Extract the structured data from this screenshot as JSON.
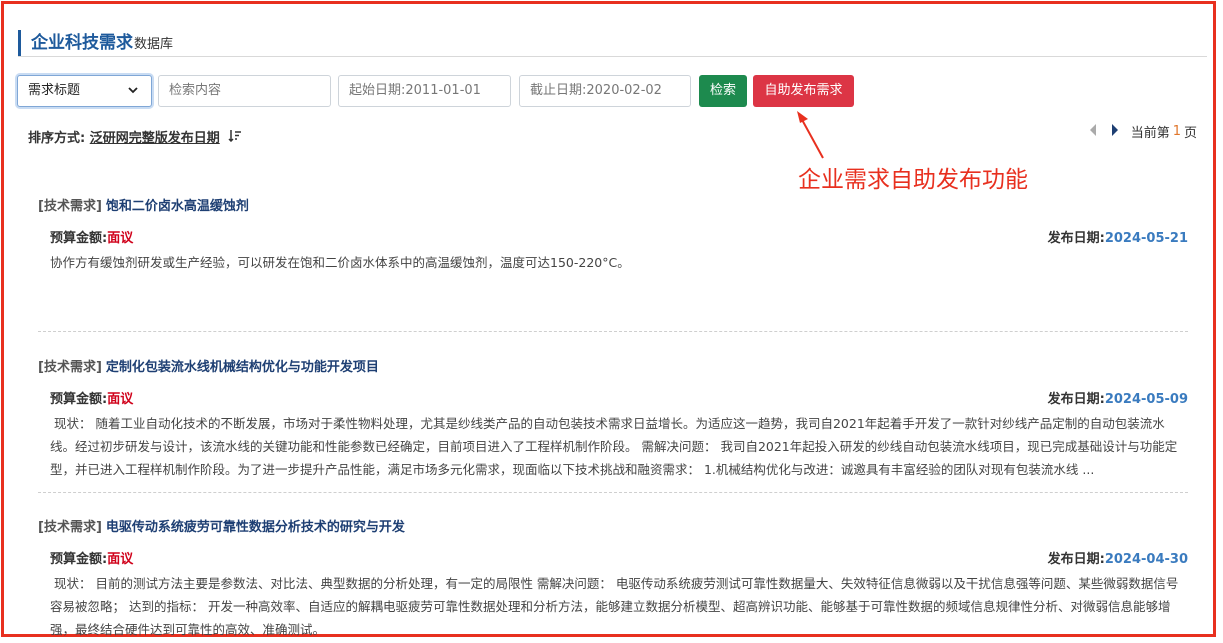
{
  "header": {
    "title_main": "企业科技需求",
    "title_sub": "数据库"
  },
  "filters": {
    "select_value": "需求标题",
    "search_placeholder": "检索内容",
    "start_date_placeholder": "起始日期:2011-01-01",
    "end_date_placeholder": "截止日期:2020-02-02",
    "search_button": "检索",
    "publish_button": "自助发布需求"
  },
  "sort": {
    "label": "排序方式:",
    "field": "泛研网完整版发布日期"
  },
  "pager": {
    "prefix": "当前第",
    "page": "1",
    "suffix": "页"
  },
  "annotation": {
    "text": "企业需求自助发布功能",
    "color": "#e8301f"
  },
  "items": [
    {
      "tag": "[技术需求]",
      "title": "饱和二价卤水高温缓蚀剂",
      "budget_label": "预算金额:",
      "budget_value": "面议",
      "date_label": "发布日期:",
      "date_value": "2024-05-21",
      "desc": "协作方有缓蚀剂研发或生产经验，可以研发在饱和二价卤水体系中的高温缓蚀剂，温度可达150-220°C。"
    },
    {
      "tag": "[技术需求]",
      "title": "定制化包装流水线机械结构优化与功能开发项目",
      "budget_label": "预算金额:",
      "budget_value": "面议",
      "date_label": "发布日期:",
      "date_value": "2024-05-09",
      "desc": " 现状： 随着工业自动化技术的不断发展，市场对于柔性物料处理，尤其是纱线类产品的自动包装技术需求日益增长。为适应这一趋势，我司自2021年起着手开发了一款针对纱线产品定制的自动包装流水线。经过初步研发与设计，该流水线的关键功能和性能参数已经确定，目前项目进入了工程样机制作阶段。 需解决问题： 我司自2021年起投入研发的纱线自动包装流水线项目，现已完成基础设计与功能定型，并已进入工程样机制作阶段。为了进一步提升产品性能，满足市场多元化需求，现面临以下技术挑战和融资需求： 1.机械结构优化与改进：诚邀具有丰富经验的团队对现有包装流水线 ..."
    },
    {
      "tag": "[技术需求]",
      "title": "电驱传动系统疲劳可靠性数据分析技术的研究与开发",
      "budget_label": "预算金额:",
      "budget_value": "面议",
      "date_label": "发布日期:",
      "date_value": "2024-04-30",
      "desc": " 现状： 目前的测试方法主要是参数法、对比法、典型数据的分析处理，有一定的局限性 需解决问题： 电驱传动系统疲劳测试可靠性数据量大、失效特征信息微弱以及干扰信息强等问题、某些微弱数据信号容易被忽略； 达到的指标： 开发一种高效率、自适应的解耦电驱疲劳可靠性数据处理和分析方法，能够建立数据分析模型、超高辨识功能、能够基于可靠性数据的频域信息规律性分析、对微弱信息能够增强，最终结合硬件达到可靠性的高效、准确测试。"
    }
  ]
}
